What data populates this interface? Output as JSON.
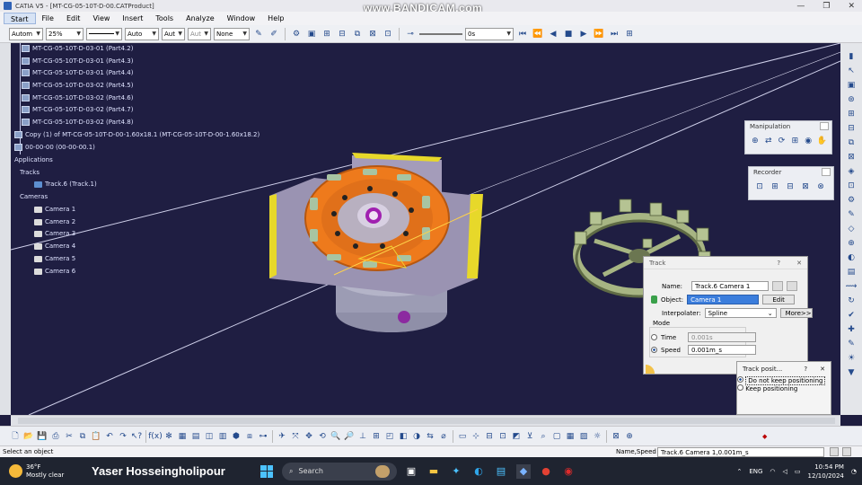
{
  "window": {
    "title": "CATIA V5 - [MT-CG-05-10T-D-00.CATProduct]"
  },
  "watermark": "www.BANDICAM.com",
  "menu": {
    "items": [
      "Start",
      "File",
      "Edit",
      "View",
      "Insert",
      "Tools",
      "Analyze",
      "Window",
      "Help"
    ]
  },
  "toolbar": {
    "combos": [
      "Autom",
      "25%",
      "",
      "Auto",
      "Aut",
      "Aut",
      "None"
    ],
    "time_value": "0s",
    "player_icons": [
      "first",
      "prev-step",
      "prev",
      "stop",
      "play",
      "next-step",
      "last"
    ]
  },
  "tree": {
    "parts": [
      "MT-CG-05-10T-D-03-01 (Part4.2)",
      "MT-CG-05-10T-D-03-01 (Part4.3)",
      "MT-CG-05-10T-D-03-01 (Part4.4)",
      "MT-CG-05-10T-D-03-02 (Part4.5)",
      "MT-CG-05-10T-D-03-02 (Part4.6)",
      "MT-CG-05-10T-D-03-02 (Part4.7)",
      "MT-CG-05-10T-D-03-02 (Part4.8)"
    ],
    "copy": "Copy (1) of MT-CG-05-10T-D-00-1.60x18.1 (MT-CG-05-10T-D-00-1.60x18.2)",
    "node00": "00-00-00 (00-00-00.1)",
    "applications": "Applications",
    "tracks": "Tracks",
    "track": "Track.6 (Track.1)",
    "cameras_label": "Cameras",
    "cameras": [
      "Camera 1",
      "Camera 2",
      "Camera 3",
      "Camera 4",
      "Camera 5",
      "Camera 6"
    ]
  },
  "manipulation": {
    "title": "Manipulation"
  },
  "recorder": {
    "title": "Recorder"
  },
  "track_dialog": {
    "title": "Track",
    "help": "?",
    "close": "✕",
    "name_label": "Name:",
    "name_value": "Track.6 Camera 1",
    "object_label": "Object:",
    "object_value": "Camera 1",
    "edit_label": "Edit",
    "interp_label": "Interpolater:",
    "interp_value": "Spline",
    "more_label": "More>>",
    "mode_label": "Mode",
    "time_label": "Time",
    "time_value": "0.001s",
    "speed_label": "Speed",
    "speed_value": "0.001m_s"
  },
  "track_pos": {
    "title": "Track posit...",
    "help": "?",
    "close": "✕",
    "opt1": "Do not keep positioning",
    "opt2": "Keep positioning"
  },
  "status": {
    "left": "Select an object",
    "right_label": "Name,Speed",
    "right_value": "Track.6 Camera 1,0.001m_s"
  },
  "taskbar": {
    "temp": "36°F",
    "weather": "Mostly clear",
    "user": "Yaser Hosseingholipour",
    "search": "Search",
    "lang": "ENG",
    "time": "10:54 PM",
    "date": "12/10/2024"
  },
  "colors": {
    "viewport": "#1f1e42",
    "accent": "#3b7ddc",
    "part_orange": "#ee7a1c"
  }
}
